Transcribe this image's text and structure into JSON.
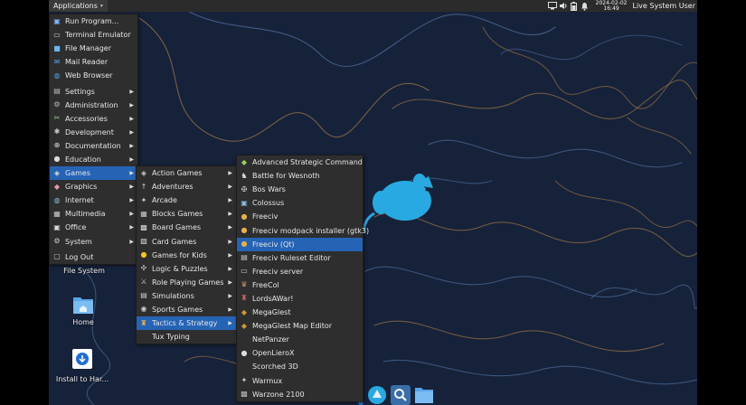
{
  "panel": {
    "applications_label": "Applications",
    "date": "2024-02-02",
    "time": "16:49",
    "user": "Live System User"
  },
  "main_menu": {
    "items": [
      {
        "label": "Run Program...",
        "icon": "run-icon",
        "submenu": false
      },
      {
        "label": "Terminal Emulator",
        "icon": "terminal-icon",
        "submenu": false
      },
      {
        "label": "File Manager",
        "icon": "folder-icon",
        "submenu": false
      },
      {
        "label": "Mail Reader",
        "icon": "mail-icon",
        "submenu": false
      },
      {
        "label": "Web Browser",
        "icon": "globe-icon",
        "submenu": false
      },
      {
        "label": "Settings",
        "icon": "settings-icon",
        "submenu": true
      },
      {
        "label": "Administration",
        "icon": "admin-icon",
        "submenu": true
      },
      {
        "label": "Accessories",
        "icon": "accessories-icon",
        "submenu": true
      },
      {
        "label": "Development",
        "icon": "development-icon",
        "submenu": true
      },
      {
        "label": "Documentation",
        "icon": "documentation-icon",
        "submenu": true
      },
      {
        "label": "Education",
        "icon": "education-icon",
        "submenu": true
      },
      {
        "label": "Games",
        "icon": "gamepad-icon",
        "submenu": true,
        "selected": true
      },
      {
        "label": "Graphics",
        "icon": "graphics-icon",
        "submenu": true
      },
      {
        "label": "Internet",
        "icon": "internet-icon",
        "submenu": true
      },
      {
        "label": "Multimedia",
        "icon": "multimedia-icon",
        "submenu": true
      },
      {
        "label": "Office",
        "icon": "office-icon",
        "submenu": true
      },
      {
        "label": "System",
        "icon": "system-icon",
        "submenu": true
      },
      {
        "label": "Log Out",
        "icon": "logout-icon",
        "submenu": false
      }
    ]
  },
  "games_menu": {
    "items": [
      {
        "label": "Action Games",
        "submenu": true
      },
      {
        "label": "Adventures",
        "submenu": true
      },
      {
        "label": "Arcade",
        "submenu": true
      },
      {
        "label": "Blocks Games",
        "submenu": true
      },
      {
        "label": "Board Games",
        "submenu": true
      },
      {
        "label": "Card Games",
        "submenu": true
      },
      {
        "label": "Games for Kids",
        "submenu": true
      },
      {
        "label": "Logic & Puzzles",
        "submenu": true
      },
      {
        "label": "Role Playing Games",
        "submenu": true
      },
      {
        "label": "Simulations",
        "submenu": true
      },
      {
        "label": "Sports Games",
        "submenu": true
      },
      {
        "label": "Tactics & Strategy",
        "submenu": true,
        "selected": true
      },
      {
        "label": "Tux Typing",
        "submenu": false
      }
    ]
  },
  "tactics_menu": {
    "items": [
      {
        "label": "Advanced Strategic Command"
      },
      {
        "label": "Battle for Wesnoth"
      },
      {
        "label": "Bos Wars"
      },
      {
        "label": "Colossus"
      },
      {
        "label": "Freeciv"
      },
      {
        "label": "Freeciv modpack installer (gtk3)"
      },
      {
        "label": "Freeciv (Qt)",
        "selected": true
      },
      {
        "label": "Freeciv Ruleset Editor"
      },
      {
        "label": "Freeciv server"
      },
      {
        "label": "FreeCol"
      },
      {
        "label": "LordsAWar!"
      },
      {
        "label": "MegaGlest"
      },
      {
        "label": "MegaGlest Map Editor"
      },
      {
        "label": "NetPanzer"
      },
      {
        "label": "OpenLieroX"
      },
      {
        "label": "Scorched 3D"
      },
      {
        "label": "Warmux"
      },
      {
        "label": "Warzone 2100"
      }
    ]
  },
  "desktop": {
    "file_system": "File System",
    "home": "Home",
    "install": "Install to Har..."
  },
  "colors": {
    "selection": "#2563b5",
    "menu_bg": "#2e2e2e",
    "wallpaper_bg": "#16223a",
    "mouse": "#29a9e1"
  }
}
